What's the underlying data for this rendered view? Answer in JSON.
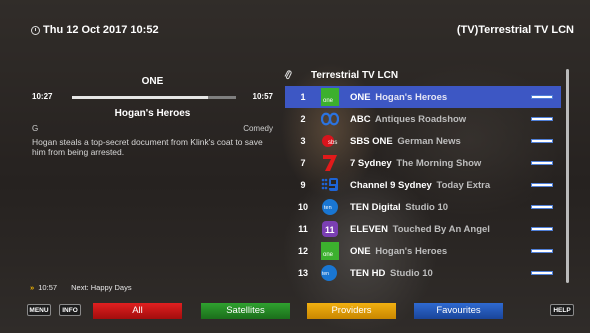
{
  "header": {
    "datetime": "Thu 12 Oct 2017  10:52",
    "network": "(TV)Terrestrial TV LCN"
  },
  "info": {
    "channel": "ONE",
    "start_time": "10:27",
    "end_time": "10:57",
    "progress": 0.83,
    "programme": "Hogan's Heroes",
    "rating": "G",
    "genre": "Comedy",
    "synopsis": "Hogan steals a top-secret document from Klink's coat to save him from being arrested."
  },
  "next": {
    "time": "10:57",
    "label": "Next: Happy Days"
  },
  "list": {
    "title": "Terrestrial TV LCN",
    "channels": [
      {
        "number": "1",
        "name": "ONE",
        "programme": "Hogan's Heroes",
        "logo": "one-logo",
        "selected": true
      },
      {
        "number": "2",
        "name": "ABC",
        "programme": "Antiques Roadshow",
        "logo": "abc-logo"
      },
      {
        "number": "3",
        "name": "SBS ONE",
        "programme": "German News",
        "logo": "sbs-logo"
      },
      {
        "number": "7",
        "name": "7 Sydney",
        "programme": "The Morning Show",
        "logo": "seven-logo"
      },
      {
        "number": "9",
        "name": "Channel 9 Sydney",
        "programme": "Today Extra",
        "logo": "nine-logo"
      },
      {
        "number": "10",
        "name": "TEN Digital",
        "programme": "Studio 10",
        "logo": "ten-logo"
      },
      {
        "number": "11",
        "name": "ELEVEN",
        "programme": "Touched By An Angel",
        "logo": "eleven-logo"
      },
      {
        "number": "12",
        "name": "ONE",
        "programme": "Hogan's Heroes",
        "logo": "one-logo"
      },
      {
        "number": "13",
        "name": "TEN HD",
        "programme": "Studio 10",
        "logo": "tenhd-logo"
      }
    ]
  },
  "footer": {
    "menu": "MENU",
    "info": "INFO",
    "red": "All",
    "green": "Satellites",
    "yellow": "Providers",
    "blue": "Favourites",
    "help": "HELP"
  },
  "colors": {
    "selected_row": "#3d57c4",
    "red": "#d01616",
    "green": "#249024",
    "yellow": "#e8a50a",
    "blue": "#2a5cbf"
  }
}
